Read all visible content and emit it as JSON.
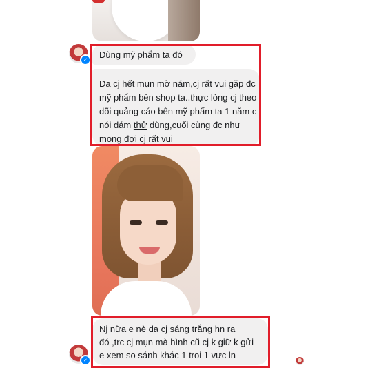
{
  "messages": [
    {
      "lines": [
        "Dùng mỹ phẩm ta đó"
      ]
    },
    {
      "lines": [
        "Da cj hết mụn mờ nám,cj rất vui gặp đc",
        "mỹ phẩm bên shop ta..thực lòng cj theo",
        "dõi quảng cáo bên mỹ phẩm ta 1 năm c",
        {
          "before": "nói dám ",
          "underlined": "thử",
          "after": " dùng,cuối cùng đc như"
        },
        "mong đợi cj rất vui"
      ]
    },
    {
      "lines": [
        "Nj nữa e nè da cj sáng trắng hn ra",
        "đó ,trc cj mụn mà hình cũ cj k giữ k gửi",
        "e xem so sánh khác 1 troi 1 vực ln"
      ]
    }
  ],
  "icons": {
    "verified_badge": "✓"
  },
  "colors": {
    "highlight": "#e11d2a",
    "bubble": "#f1f0f0",
    "badge": "#0084ff"
  }
}
